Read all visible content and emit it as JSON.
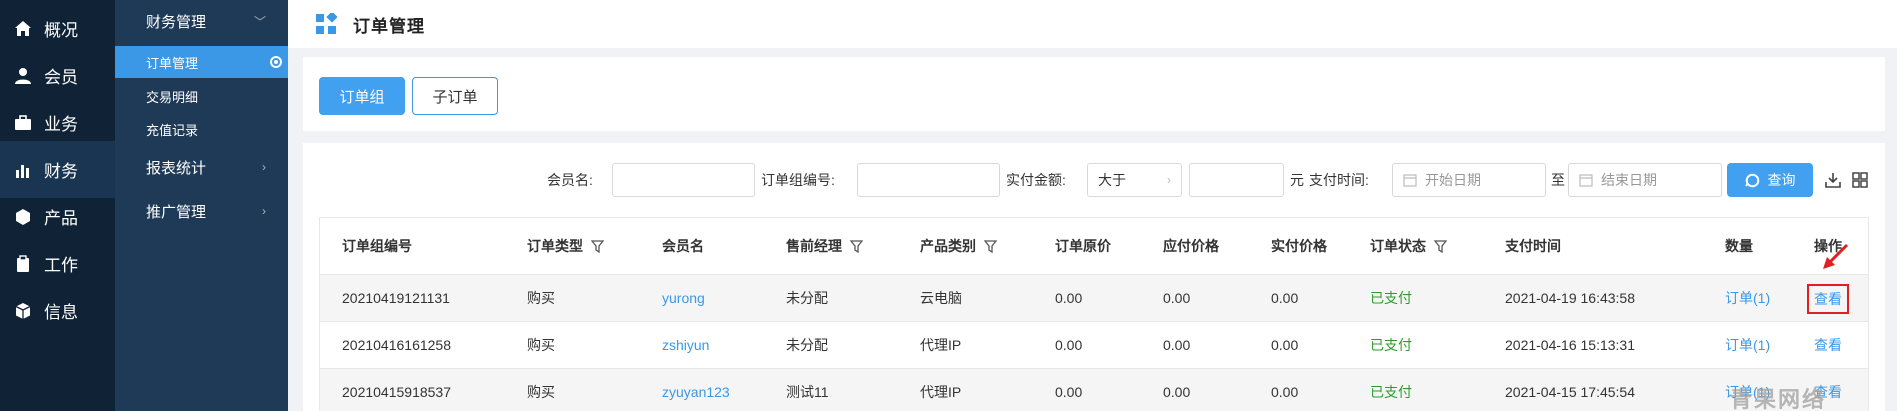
{
  "nav_primary": [
    {
      "label": "概况",
      "icon": "home-icon"
    },
    {
      "label": "会员",
      "icon": "user-icon"
    },
    {
      "label": "业务",
      "icon": "briefcase-icon"
    },
    {
      "label": "财务",
      "icon": "bar-chart-icon",
      "active": true
    },
    {
      "label": "产品",
      "icon": "cube-icon"
    },
    {
      "label": "工作",
      "icon": "clipboard-icon"
    },
    {
      "label": "信息",
      "icon": "box-icon"
    }
  ],
  "nav_secondary": {
    "finance": "财务管理",
    "order_mgmt": "订单管理",
    "transactions": "交易明细",
    "recharge": "充值记录",
    "reports": "报表统计",
    "promotion": "推广管理"
  },
  "header": {
    "title": "订单管理"
  },
  "tabs": {
    "group": "订单组",
    "sub": "子订单"
  },
  "filters": {
    "member_label": "会员名:",
    "group_no_label": "订单组编号:",
    "amount_label": "实付金额:",
    "amount_op": "大于",
    "unit": "元",
    "paytime_label": "支付时间:",
    "start_placeholder": "开始日期",
    "to": "至",
    "end_placeholder": "结束日期",
    "query": "查询"
  },
  "table": {
    "headers": {
      "group_no": "订单组编号",
      "type": "订单类型",
      "member": "会员名",
      "manager": "售前经理",
      "category": "产品类别",
      "original": "订单原价",
      "payable": "应付价格",
      "paid": "实付价格",
      "status": "订单状态",
      "pay_time": "支付时间",
      "qty": "数量",
      "action": "操作"
    },
    "rows": [
      {
        "group_no": "20210419121131",
        "type": "购买",
        "member": "yurong",
        "manager": "未分配",
        "category": "云电脑",
        "original": "0.00",
        "payable": "0.00",
        "paid": "0.00",
        "status": "已支付",
        "pay_time": "2021-04-19 16:43:58",
        "qty": "订单(1)",
        "action": "查看"
      },
      {
        "group_no": "20210416161258",
        "type": "购买",
        "member": "zshiyun",
        "manager": "未分配",
        "category": "代理IP",
        "original": "0.00",
        "payable": "0.00",
        "paid": "0.00",
        "status": "已支付",
        "pay_time": "2021-04-16 15:13:31",
        "qty": "订单(1)",
        "action": "查看"
      },
      {
        "group_no": "20210415918537",
        "type": "购买",
        "member": "zyuyan123",
        "manager": "测试11",
        "category": "代理IP",
        "original": "0.00",
        "payable": "0.00",
        "paid": "0.00",
        "status": "已支付",
        "pay_time": "2021-04-15 17:45:54",
        "qty": "订单(1)",
        "action": "查看"
      }
    ]
  },
  "watermark": "青果网络",
  "colors": {
    "accent": "#3a98e6",
    "paid": "#2e9a2e",
    "highlight": "#e02020",
    "sidebar_dark": "#0f2236",
    "sidebar_mid": "#1e3a57"
  }
}
